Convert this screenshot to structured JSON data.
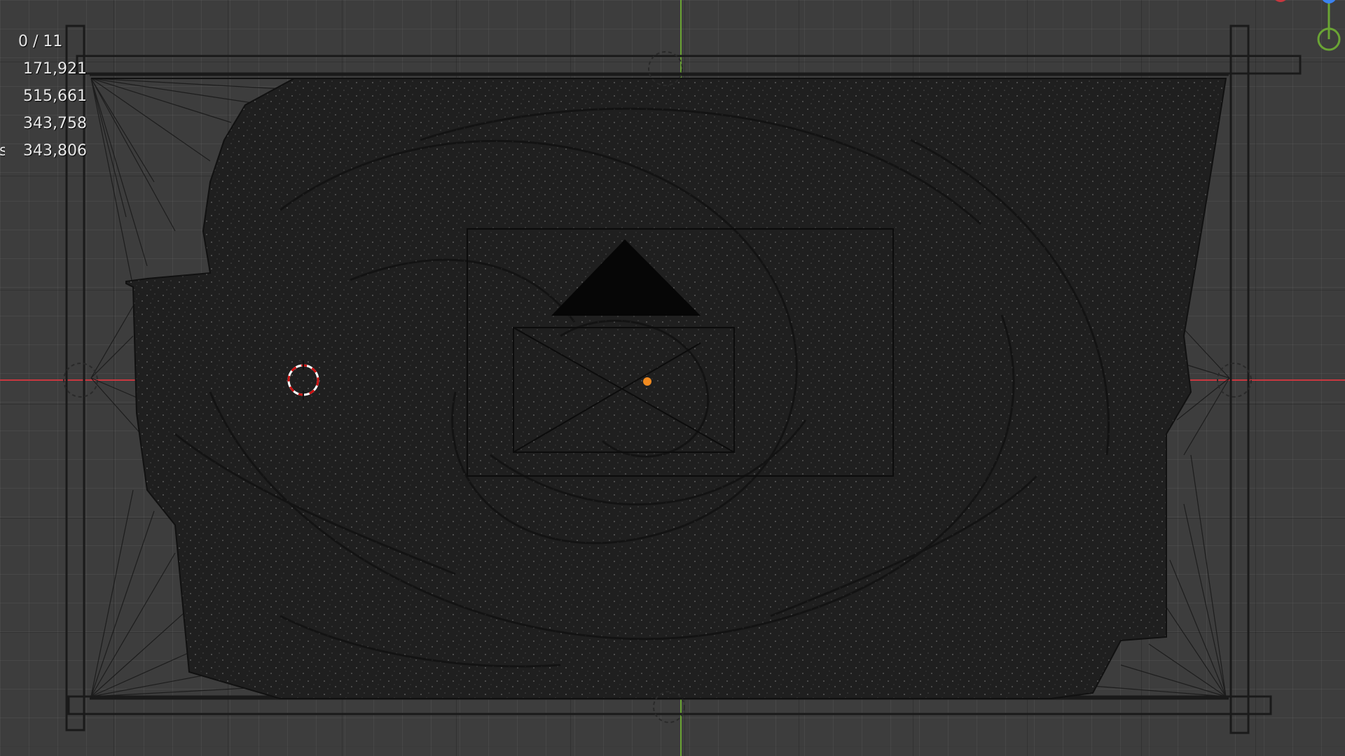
{
  "app": "Blender",
  "viewport": {
    "view": "Top Orthographic",
    "axis_colors": {
      "x": "#c8373f",
      "y": "#6aa434",
      "z": "#3b82f0"
    },
    "mesh_color": "#1c1c1c",
    "origin_color": "#f08a20",
    "cursor_color": "#cc1111"
  },
  "stats": {
    "rows": [
      {
        "label": "",
        "value": "0 / 11"
      },
      {
        "label": "",
        "value": "171,921"
      },
      {
        "label": "",
        "value": "515,661"
      },
      {
        "label": "",
        "value": "343,758"
      },
      {
        "label": "s",
        "value": "343,806"
      }
    ]
  },
  "gizmo": {
    "icons": [
      "x-axis-icon",
      "z-axis-icon",
      "y-axis-icon"
    ]
  }
}
